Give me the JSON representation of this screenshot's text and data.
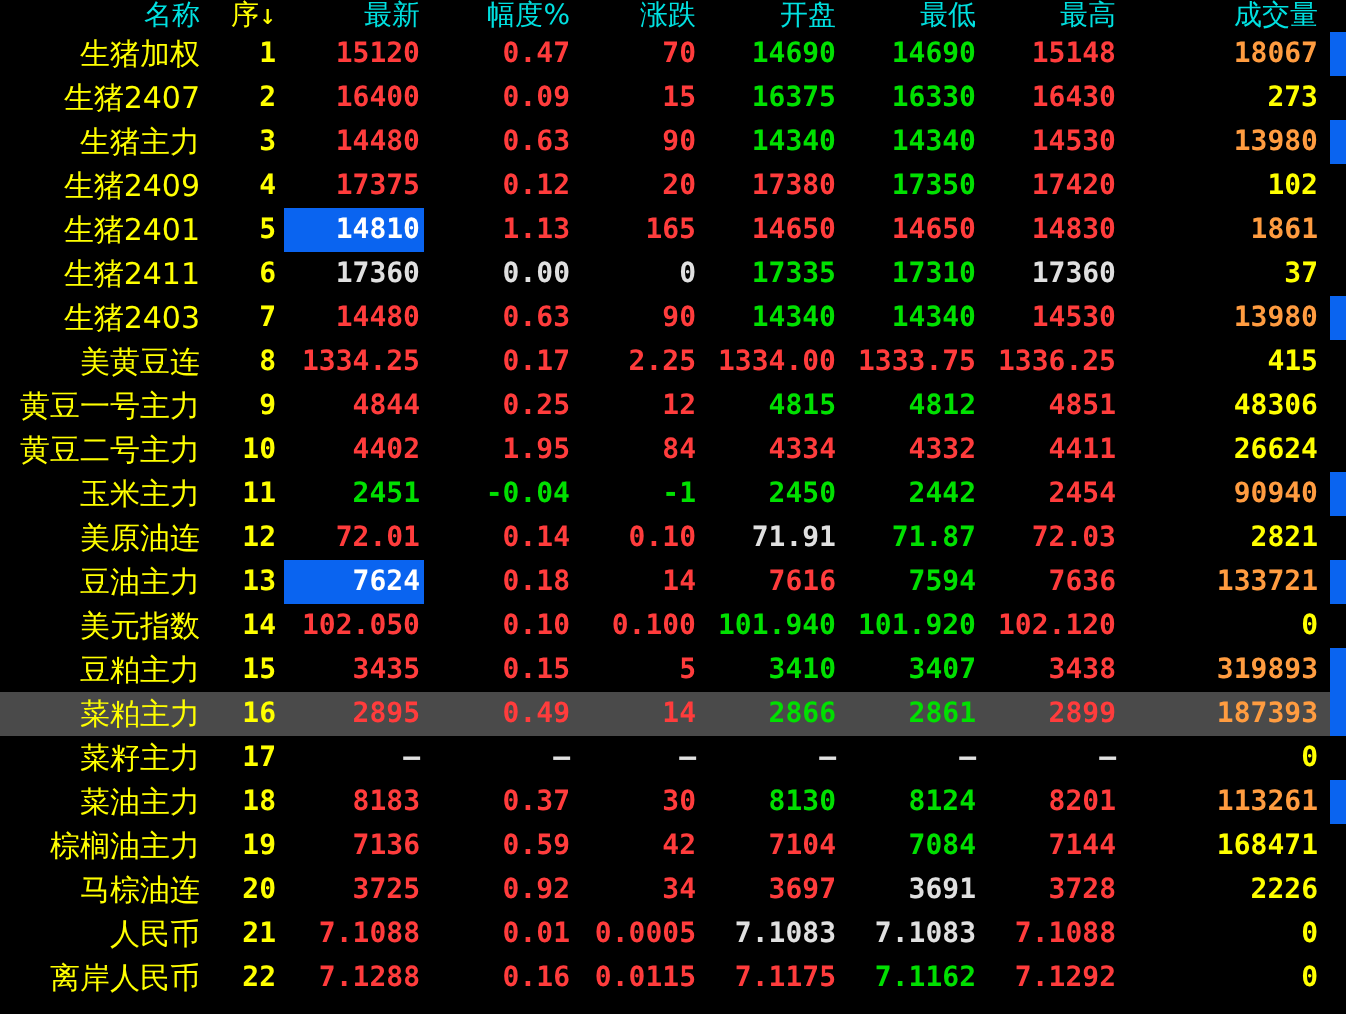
{
  "columns": [
    {
      "label": "名称",
      "color": "#00e0e0"
    },
    {
      "label": "序",
      "color": "#ffff00",
      "sort_mark": "↓"
    },
    {
      "label": "最新",
      "color": "#00e0e0"
    },
    {
      "label": "幅度%",
      "color": "#00e0e0"
    },
    {
      "label": "涨跌",
      "color": "#00e0e0"
    },
    {
      "label": "开盘",
      "color": "#00e0e0"
    },
    {
      "label": "最低",
      "color": "#00e0e0"
    },
    {
      "label": "最高",
      "color": "#00e0e0"
    },
    {
      "label": "成交量",
      "color": "#00e0e0"
    }
  ],
  "rows": [
    {
      "name": "生猪加权",
      "no": "1",
      "selected": false,
      "highlighted": false,
      "flag": true,
      "cells": [
        {
          "text": "15120",
          "color": "#ff3c3c"
        },
        {
          "text": "0.47",
          "color": "#ff3c3c"
        },
        {
          "text": "70",
          "color": "#ff3c3c"
        },
        {
          "text": "14690",
          "color": "#00e000"
        },
        {
          "text": "14690",
          "color": "#00e000"
        },
        {
          "text": "15148",
          "color": "#ff3c3c"
        }
      ],
      "volume": {
        "text": "18067",
        "color": "#ff9c40"
      }
    },
    {
      "name": "生猪2407",
      "no": "2",
      "selected": false,
      "highlighted": false,
      "flag": false,
      "cells": [
        {
          "text": "16400",
          "color": "#ff3c3c"
        },
        {
          "text": "0.09",
          "color": "#ff3c3c"
        },
        {
          "text": "15",
          "color": "#ff3c3c"
        },
        {
          "text": "16375",
          "color": "#00e000"
        },
        {
          "text": "16330",
          "color": "#00e000"
        },
        {
          "text": "16430",
          "color": "#ff3c3c"
        }
      ],
      "volume": {
        "text": "273",
        "color": "#ffff00"
      }
    },
    {
      "name": "生猪主力",
      "no": "3",
      "selected": false,
      "highlighted": false,
      "flag": true,
      "cells": [
        {
          "text": "14480",
          "color": "#ff3c3c"
        },
        {
          "text": "0.63",
          "color": "#ff3c3c"
        },
        {
          "text": "90",
          "color": "#ff3c3c"
        },
        {
          "text": "14340",
          "color": "#00e000"
        },
        {
          "text": "14340",
          "color": "#00e000"
        },
        {
          "text": "14530",
          "color": "#ff3c3c"
        }
      ],
      "volume": {
        "text": "13980",
        "color": "#ff9c40"
      }
    },
    {
      "name": "生猪2409",
      "no": "4",
      "selected": false,
      "highlighted": false,
      "flag": false,
      "cells": [
        {
          "text": "17375",
          "color": "#ff3c3c"
        },
        {
          "text": "0.12",
          "color": "#ff3c3c"
        },
        {
          "text": "20",
          "color": "#ff3c3c"
        },
        {
          "text": "17380",
          "color": "#ff3c3c"
        },
        {
          "text": "17350",
          "color": "#00e000"
        },
        {
          "text": "17420",
          "color": "#ff3c3c"
        }
      ],
      "volume": {
        "text": "102",
        "color": "#ffff00"
      }
    },
    {
      "name": "生猪2401",
      "no": "5",
      "selected": false,
      "highlighted": true,
      "flag": false,
      "cells": [
        {
          "text": "14810",
          "color": "#ffffff"
        },
        {
          "text": "1.13",
          "color": "#ff3c3c"
        },
        {
          "text": "165",
          "color": "#ff3c3c"
        },
        {
          "text": "14650",
          "color": "#ff3c3c"
        },
        {
          "text": "14650",
          "color": "#ff3c3c"
        },
        {
          "text": "14830",
          "color": "#ff3c3c"
        }
      ],
      "volume": {
        "text": "1861",
        "color": "#ff9c40"
      }
    },
    {
      "name": "生猪2411",
      "no": "6",
      "selected": false,
      "highlighted": false,
      "flag": false,
      "cells": [
        {
          "text": "17360",
          "color": "#e0e0e0"
        },
        {
          "text": "0.00",
          "color": "#e0e0e0"
        },
        {
          "text": "0",
          "color": "#e0e0e0"
        },
        {
          "text": "17335",
          "color": "#00e000"
        },
        {
          "text": "17310",
          "color": "#00e000"
        },
        {
          "text": "17360",
          "color": "#e0e0e0"
        }
      ],
      "volume": {
        "text": "37",
        "color": "#ffff00"
      }
    },
    {
      "name": "生猪2403",
      "no": "7",
      "selected": false,
      "highlighted": false,
      "flag": true,
      "cells": [
        {
          "text": "14480",
          "color": "#ff3c3c"
        },
        {
          "text": "0.63",
          "color": "#ff3c3c"
        },
        {
          "text": "90",
          "color": "#ff3c3c"
        },
        {
          "text": "14340",
          "color": "#00e000"
        },
        {
          "text": "14340",
          "color": "#00e000"
        },
        {
          "text": "14530",
          "color": "#ff3c3c"
        }
      ],
      "volume": {
        "text": "13980",
        "color": "#ff9c40"
      }
    },
    {
      "name": "美黄豆连",
      "no": "8",
      "selected": false,
      "highlighted": false,
      "flag": false,
      "cells": [
        {
          "text": "1334.25",
          "color": "#ff3c3c"
        },
        {
          "text": "0.17",
          "color": "#ff3c3c"
        },
        {
          "text": "2.25",
          "color": "#ff3c3c"
        },
        {
          "text": "1334.00",
          "color": "#ff3c3c"
        },
        {
          "text": "1333.75",
          "color": "#ff3c3c"
        },
        {
          "text": "1336.25",
          "color": "#ff3c3c"
        }
      ],
      "volume": {
        "text": "415",
        "color": "#ffff00"
      }
    },
    {
      "name": "黄豆一号主力",
      "no": "9",
      "selected": false,
      "highlighted": false,
      "flag": false,
      "cells": [
        {
          "text": "4844",
          "color": "#ff3c3c"
        },
        {
          "text": "0.25",
          "color": "#ff3c3c"
        },
        {
          "text": "12",
          "color": "#ff3c3c"
        },
        {
          "text": "4815",
          "color": "#00e000"
        },
        {
          "text": "4812",
          "color": "#00e000"
        },
        {
          "text": "4851",
          "color": "#ff3c3c"
        }
      ],
      "volume": {
        "text": "48306",
        "color": "#ffff00"
      }
    },
    {
      "name": "黄豆二号主力",
      "no": "10",
      "selected": false,
      "highlighted": false,
      "flag": false,
      "cells": [
        {
          "text": "4402",
          "color": "#ff3c3c"
        },
        {
          "text": "1.95",
          "color": "#ff3c3c"
        },
        {
          "text": "84",
          "color": "#ff3c3c"
        },
        {
          "text": "4334",
          "color": "#ff3c3c"
        },
        {
          "text": "4332",
          "color": "#ff3c3c"
        },
        {
          "text": "4411",
          "color": "#ff3c3c"
        }
      ],
      "volume": {
        "text": "26624",
        "color": "#ffff00"
      }
    },
    {
      "name": "玉米主力",
      "no": "11",
      "selected": false,
      "highlighted": false,
      "flag": true,
      "cells": [
        {
          "text": "2451",
          "color": "#00e000"
        },
        {
          "text": "-0.04",
          "color": "#00e000"
        },
        {
          "text": "-1",
          "color": "#00e000"
        },
        {
          "text": "2450",
          "color": "#00e000"
        },
        {
          "text": "2442",
          "color": "#00e000"
        },
        {
          "text": "2454",
          "color": "#ff3c3c"
        }
      ],
      "volume": {
        "text": "90940",
        "color": "#ff9c40"
      }
    },
    {
      "name": "美原油连",
      "no": "12",
      "selected": false,
      "highlighted": false,
      "flag": false,
      "cells": [
        {
          "text": "72.01",
          "color": "#ff3c3c"
        },
        {
          "text": "0.14",
          "color": "#ff3c3c"
        },
        {
          "text": "0.10",
          "color": "#ff3c3c"
        },
        {
          "text": "71.91",
          "color": "#e0e0e0"
        },
        {
          "text": "71.87",
          "color": "#00e000"
        },
        {
          "text": "72.03",
          "color": "#ff3c3c"
        }
      ],
      "volume": {
        "text": "2821",
        "color": "#ffff00"
      }
    },
    {
      "name": "豆油主力",
      "no": "13",
      "selected": false,
      "highlighted": true,
      "flag": true,
      "cells": [
        {
          "text": "7624",
          "color": "#ffffff"
        },
        {
          "text": "0.18",
          "color": "#ff3c3c"
        },
        {
          "text": "14",
          "color": "#ff3c3c"
        },
        {
          "text": "7616",
          "color": "#ff3c3c"
        },
        {
          "text": "7594",
          "color": "#00e000"
        },
        {
          "text": "7636",
          "color": "#ff3c3c"
        }
      ],
      "volume": {
        "text": "133721",
        "color": "#ff9c40"
      }
    },
    {
      "name": "美元指数",
      "no": "14",
      "selected": false,
      "highlighted": false,
      "flag": false,
      "cells": [
        {
          "text": "102.050",
          "color": "#ff3c3c"
        },
        {
          "text": "0.10",
          "color": "#ff3c3c"
        },
        {
          "text": "0.100",
          "color": "#ff3c3c"
        },
        {
          "text": "101.940",
          "color": "#00e000"
        },
        {
          "text": "101.920",
          "color": "#00e000"
        },
        {
          "text": "102.120",
          "color": "#ff3c3c"
        }
      ],
      "volume": {
        "text": "0",
        "color": "#ffff00"
      }
    },
    {
      "name": "豆粕主力",
      "no": "15",
      "selected": false,
      "highlighted": false,
      "flag": true,
      "cells": [
        {
          "text": "3435",
          "color": "#ff3c3c"
        },
        {
          "text": "0.15",
          "color": "#ff3c3c"
        },
        {
          "text": "5",
          "color": "#ff3c3c"
        },
        {
          "text": "3410",
          "color": "#00e000"
        },
        {
          "text": "3407",
          "color": "#00e000"
        },
        {
          "text": "3438",
          "color": "#ff3c3c"
        }
      ],
      "volume": {
        "text": "319893",
        "color": "#ff9c40"
      }
    },
    {
      "name": "菜粕主力",
      "no": "16",
      "selected": true,
      "highlighted": false,
      "flag": true,
      "cells": [
        {
          "text": "2895",
          "color": "#ff3c3c"
        },
        {
          "text": "0.49",
          "color": "#ff3c3c"
        },
        {
          "text": "14",
          "color": "#ff3c3c"
        },
        {
          "text": "2866",
          "color": "#00e000"
        },
        {
          "text": "2861",
          "color": "#00e000"
        },
        {
          "text": "2899",
          "color": "#ff3c3c"
        }
      ],
      "volume": {
        "text": "187393",
        "color": "#ff9c40"
      }
    },
    {
      "name": "菜籽主力",
      "no": "17",
      "selected": false,
      "highlighted": false,
      "flag": false,
      "cells": [
        {
          "text": "—",
          "color": "#e0e0e0"
        },
        {
          "text": "—",
          "color": "#e0e0e0"
        },
        {
          "text": "—",
          "color": "#e0e0e0"
        },
        {
          "text": "—",
          "color": "#e0e0e0"
        },
        {
          "text": "—",
          "color": "#e0e0e0"
        },
        {
          "text": "—",
          "color": "#e0e0e0"
        }
      ],
      "volume": {
        "text": "0",
        "color": "#ffff00"
      }
    },
    {
      "name": "菜油主力",
      "no": "18",
      "selected": false,
      "highlighted": false,
      "flag": true,
      "cells": [
        {
          "text": "8183",
          "color": "#ff3c3c"
        },
        {
          "text": "0.37",
          "color": "#ff3c3c"
        },
        {
          "text": "30",
          "color": "#ff3c3c"
        },
        {
          "text": "8130",
          "color": "#00e000"
        },
        {
          "text": "8124",
          "color": "#00e000"
        },
        {
          "text": "8201",
          "color": "#ff3c3c"
        }
      ],
      "volume": {
        "text": "113261",
        "color": "#ff9c40"
      }
    },
    {
      "name": "棕榈油主力",
      "no": "19",
      "selected": false,
      "highlighted": false,
      "flag": false,
      "cells": [
        {
          "text": "7136",
          "color": "#ff3c3c"
        },
        {
          "text": "0.59",
          "color": "#ff3c3c"
        },
        {
          "text": "42",
          "color": "#ff3c3c"
        },
        {
          "text": "7104",
          "color": "#ff3c3c"
        },
        {
          "text": "7084",
          "color": "#00e000"
        },
        {
          "text": "7144",
          "color": "#ff3c3c"
        }
      ],
      "volume": {
        "text": "168471",
        "color": "#ffff00"
      }
    },
    {
      "name": "马棕油连",
      "no": "20",
      "selected": false,
      "highlighted": false,
      "flag": false,
      "cells": [
        {
          "text": "3725",
          "color": "#ff3c3c"
        },
        {
          "text": "0.92",
          "color": "#ff3c3c"
        },
        {
          "text": "34",
          "color": "#ff3c3c"
        },
        {
          "text": "3697",
          "color": "#ff3c3c"
        },
        {
          "text": "3691",
          "color": "#e0e0e0"
        },
        {
          "text": "3728",
          "color": "#ff3c3c"
        }
      ],
      "volume": {
        "text": "2226",
        "color": "#ffff00"
      }
    },
    {
      "name": "人民币",
      "no": "21",
      "selected": false,
      "highlighted": false,
      "flag": false,
      "cells": [
        {
          "text": "7.1088",
          "color": "#ff3c3c"
        },
        {
          "text": "0.01",
          "color": "#ff3c3c"
        },
        {
          "text": "0.0005",
          "color": "#ff3c3c"
        },
        {
          "text": "7.1083",
          "color": "#e0e0e0"
        },
        {
          "text": "7.1083",
          "color": "#e0e0e0"
        },
        {
          "text": "7.1088",
          "color": "#ff3c3c"
        }
      ],
      "volume": {
        "text": "0",
        "color": "#ffff00"
      }
    },
    {
      "name": "离岸人民币",
      "no": "22",
      "selected": false,
      "highlighted": false,
      "flag": false,
      "cells": [
        {
          "text": "7.1288",
          "color": "#ff3c3c"
        },
        {
          "text": "0.16",
          "color": "#ff3c3c"
        },
        {
          "text": "0.0115",
          "color": "#ff3c3c"
        },
        {
          "text": "7.1175",
          "color": "#ff3c3c"
        },
        {
          "text": "7.1162",
          "color": "#00e000"
        },
        {
          "text": "7.1292",
          "color": "#ff3c3c"
        }
      ],
      "volume": {
        "text": "0",
        "color": "#ffff00"
      }
    }
  ]
}
